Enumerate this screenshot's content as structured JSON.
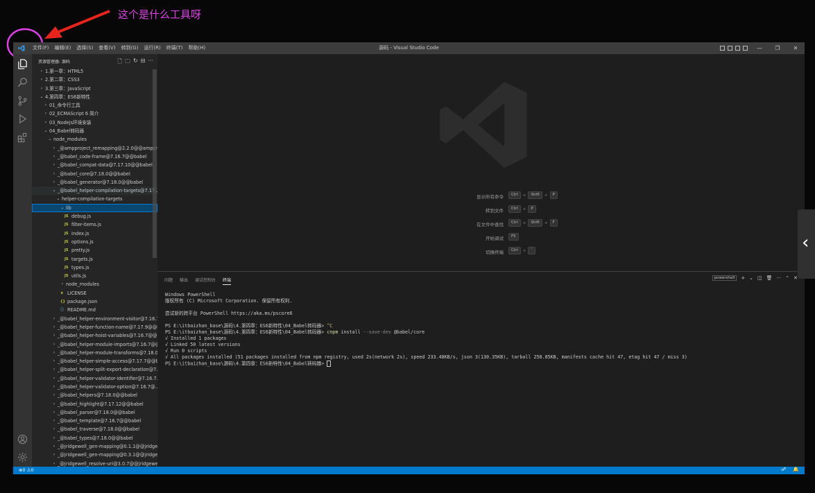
{
  "annotation": {
    "text": "这个是什么工具呀",
    "color": "#e040e8"
  },
  "window": {
    "title": "源码 - Visual Studio Code",
    "menus": [
      "文件(F)",
      "编辑(E)",
      "选择(S)",
      "查看(V)",
      "转到(G)",
      "运行(R)",
      "终端(T)",
      "帮助(H)"
    ],
    "controls": {
      "minimize": "—",
      "restore": "❐",
      "close": "✕"
    }
  },
  "activity_bar": {
    "items": [
      "explorer-icon",
      "search-icon",
      "source-control-icon",
      "run-debug-icon",
      "extensions-icon"
    ],
    "bottom": [
      "account-icon",
      "settings-gear-icon"
    ]
  },
  "explorer": {
    "title": "资源管理器: 源码",
    "tree": [
      {
        "label": "1.第一章：HTML5",
        "indent": 0,
        "type": "folder",
        "state": "collapsed"
      },
      {
        "label": "2.第二章：CSS3",
        "indent": 0,
        "type": "folder",
        "state": "collapsed"
      },
      {
        "label": "3.第三章：JavaScript",
        "indent": 0,
        "type": "folder",
        "state": "collapsed"
      },
      {
        "label": "4.第四章：ES6新特性",
        "indent": 0,
        "type": "folder",
        "state": "expanded"
      },
      {
        "label": "01_命令行工具",
        "indent": 1,
        "type": "folder",
        "state": "collapsed"
      },
      {
        "label": "02_ECMAScript 6 简介",
        "indent": 1,
        "type": "folder",
        "state": "collapsed"
      },
      {
        "label": "03_Nodejs环境安装",
        "indent": 1,
        "type": "folder",
        "state": "collapsed"
      },
      {
        "label": "04_Babel转码器",
        "indent": 1,
        "type": "folder",
        "state": "expanded"
      },
      {
        "label": "node_modules",
        "indent": 2,
        "type": "folder",
        "state": "expanded"
      },
      {
        "label": "_@ampproject_remapping@2.2.0@@ampproject",
        "indent": 3,
        "type": "folder",
        "state": "collapsed"
      },
      {
        "label": "_@babel_code-frame@7.16.7@@babel",
        "indent": 3,
        "type": "folder",
        "state": "collapsed"
      },
      {
        "label": "_@babel_compat-data@7.17.10@@babel",
        "indent": 3,
        "type": "folder",
        "state": "collapsed"
      },
      {
        "label": "_@babel_core@7.18.0@@babel",
        "indent": 3,
        "type": "folder",
        "state": "collapsed"
      },
      {
        "label": "_@babel_generator@7.18.0@@babel",
        "indent": 3,
        "type": "folder",
        "state": "collapsed"
      },
      {
        "label": "_@babel_helper-compilation-targets@7.17...",
        "indent": 3,
        "type": "folder",
        "state": "expanded",
        "hover": true
      },
      {
        "label": "helper-compilation-targets",
        "indent": 4,
        "type": "folder",
        "state": "expanded"
      },
      {
        "label": "lib",
        "indent": 5,
        "type": "folder",
        "state": "expanded",
        "selected": true
      },
      {
        "label": "debug.js",
        "indent": 6,
        "type": "js"
      },
      {
        "label": "filter-items.js",
        "indent": 6,
        "type": "js"
      },
      {
        "label": "index.js",
        "indent": 6,
        "type": "js"
      },
      {
        "label": "options.js",
        "indent": 6,
        "type": "js"
      },
      {
        "label": "pretty.js",
        "indent": 6,
        "type": "js"
      },
      {
        "label": "targets.js",
        "indent": 6,
        "type": "js"
      },
      {
        "label": "types.js",
        "indent": 6,
        "type": "js"
      },
      {
        "label": "utils.js",
        "indent": 6,
        "type": "js"
      },
      {
        "label": "node_modules",
        "indent": 5,
        "type": "folder",
        "state": "collapsed"
      },
      {
        "label": "LICENSE",
        "indent": 5,
        "type": "license"
      },
      {
        "label": "package.json",
        "indent": 5,
        "type": "json"
      },
      {
        "label": "README.md",
        "indent": 5,
        "type": "md"
      },
      {
        "label": "_@babel_helper-environment-visitor@7.16.7...",
        "indent": 3,
        "type": "folder",
        "state": "collapsed"
      },
      {
        "label": "_@babel_helper-function-name@7.17.9@@b...",
        "indent": 3,
        "type": "folder",
        "state": "collapsed"
      },
      {
        "label": "_@babel_helper-hoist-variables@7.16.7@@...",
        "indent": 3,
        "type": "folder",
        "state": "collapsed"
      },
      {
        "label": "_@babel_helper-module-imports@7.16.7@@...",
        "indent": 3,
        "type": "folder",
        "state": "collapsed"
      },
      {
        "label": "_@babel_helper-module-transforms@7.18.0...",
        "indent": 3,
        "type": "folder",
        "state": "collapsed"
      },
      {
        "label": "_@babel_helper-simple-access@7.17.7@@b...",
        "indent": 3,
        "type": "folder",
        "state": "collapsed"
      },
      {
        "label": "_@babel_helper-split-export-declaration@7...",
        "indent": 3,
        "type": "folder",
        "state": "collapsed"
      },
      {
        "label": "_@babel_helper-validator-identifier@7.16.7...",
        "indent": 3,
        "type": "folder",
        "state": "collapsed"
      },
      {
        "label": "_@babel_helper-validator-option@7.16.7@...",
        "indent": 3,
        "type": "folder",
        "state": "collapsed"
      },
      {
        "label": "_@babel_helpers@7.18.0@@babel",
        "indent": 3,
        "type": "folder",
        "state": "collapsed"
      },
      {
        "label": "_@babel_highlight@7.17.12@@babel",
        "indent": 3,
        "type": "folder",
        "state": "collapsed"
      },
      {
        "label": "_@babel_parser@7.18.0@@babel",
        "indent": 3,
        "type": "folder",
        "state": "collapsed"
      },
      {
        "label": "_@babel_template@7.16.7@@babel",
        "indent": 3,
        "type": "folder",
        "state": "collapsed"
      },
      {
        "label": "_@babel_traverse@7.18.0@@babel",
        "indent": 3,
        "type": "folder",
        "state": "collapsed"
      },
      {
        "label": "_@babel_types@7.18.0@@babel",
        "indent": 3,
        "type": "folder",
        "state": "collapsed"
      },
      {
        "label": "_@jridgewell_gen-mapping@0.1.1@@jridge...",
        "indent": 3,
        "type": "folder",
        "state": "collapsed"
      },
      {
        "label": "_@jridgewell_gen-mapping@0.3.1@@jridge...",
        "indent": 3,
        "type": "folder",
        "state": "collapsed"
      },
      {
        "label": "_@jridgewell_resolve-uri@3.0.7@@jridgewell",
        "indent": 3,
        "type": "folder",
        "state": "collapsed"
      }
    ]
  },
  "welcome": {
    "shortcuts": [
      {
        "label": "显示所有命令",
        "keys": [
          "Ctrl",
          "Shift",
          "P"
        ]
      },
      {
        "label": "转到文件",
        "keys": [
          "Ctrl",
          "P"
        ]
      },
      {
        "label": "在文件中查找",
        "keys": [
          "Ctrl",
          "Shift",
          "F"
        ]
      },
      {
        "label": "开始调试",
        "keys": [
          "F5"
        ]
      },
      {
        "label": "切换终端",
        "keys": [
          "Ctrl",
          "`"
        ]
      }
    ]
  },
  "panel": {
    "tabs": [
      "问题",
      "输出",
      "调试控制台",
      "终端"
    ],
    "active_tab": "终端",
    "terminal_name": "powershell",
    "lines": [
      {
        "text": "Windows PowerShell"
      },
      {
        "text": "版权所有 (C) Microsoft Corporation. 保留所有权利."
      },
      {
        "text": ""
      },
      {
        "text": "尝试新的跨平台 PowerShell https://aka.ms/pscore6"
      },
      {
        "text": ""
      },
      {
        "prompt": "PS E:\\itbaizhan_base\\源码\\4.第四章：ES6新特性\\04_Babel转码器> ",
        "ctrl": "^C"
      },
      {
        "prompt": "PS E:\\itbaizhan_base\\源码\\4.第四章：ES6新特性\\04_Babel转码器> ",
        "cmd": "cnpm",
        "rest1": " install ",
        "flag": "--save-dev",
        "rest2": " @babel/core"
      },
      {
        "text": "√ Installed 1 packages"
      },
      {
        "text": "√ Linked 50 latest versions"
      },
      {
        "text": "√ Run 0 scripts"
      },
      {
        "text": "√ All packages installed (51 packages installed from npm registry, used 2s(network 2s), speed 233.48KB/s, json 3(130.35KB), tarball 258.85KB, manifests cache hit 47, etag hit 47 / miss 3)"
      },
      {
        "prompt": "PS E:\\itbaizhan_base\\源码\\4.第四章：ES6新特性\\04_Babel转码器> ",
        "cursor": true
      }
    ]
  },
  "statusbar": {
    "errors": "0",
    "warnings": "0"
  },
  "colors": {
    "statusbar": "#007acc",
    "selection": "#094771",
    "titlebar": "#3c3c3c",
    "sidebar": "#252526",
    "editor": "#1e1e1e"
  }
}
